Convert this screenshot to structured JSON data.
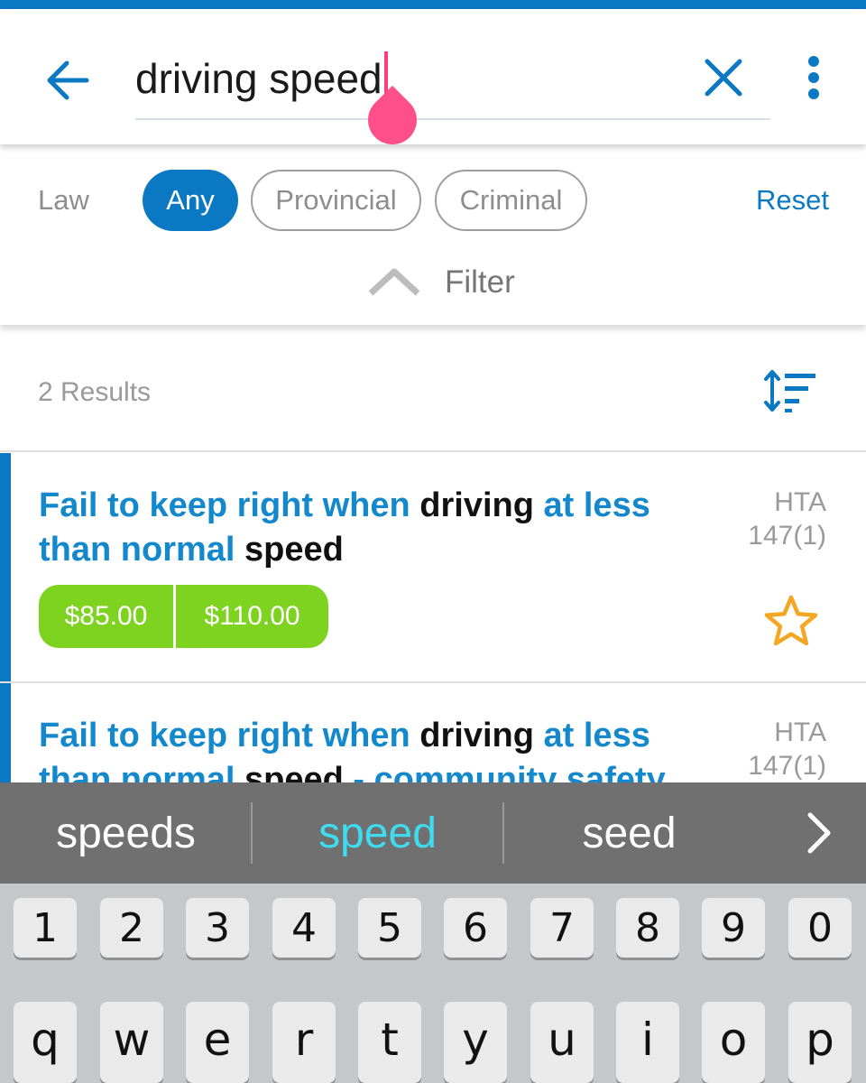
{
  "search": {
    "query": "driving speed"
  },
  "filter": {
    "law_label": "Law",
    "chips": [
      {
        "label": "Any",
        "selected": true
      },
      {
        "label": "Provincial",
        "selected": false
      },
      {
        "label": "Criminal",
        "selected": false
      }
    ],
    "reset_label": "Reset",
    "toggle_label": "Filter"
  },
  "results": {
    "count_label": "2 Results",
    "items": [
      {
        "title_parts": [
          "Fail to keep right when ",
          "driving",
          " at less than normal ",
          "speed"
        ],
        "code_line1": "HTA",
        "code_line2": "147(1)",
        "fines": [
          "$85.00",
          "$110.00"
        ],
        "starred": false
      },
      {
        "title_parts": [
          "Fail to keep right when ",
          "driving",
          " at less than normal ",
          "speed",
          " - community safety"
        ],
        "code_line1": "HTA",
        "code_line2": "147(1)"
      }
    ]
  },
  "suggestions": [
    "speeds",
    "speed",
    "seed"
  ],
  "keyboard": {
    "row1": [
      "1",
      "2",
      "3",
      "4",
      "5",
      "6",
      "7",
      "8",
      "9",
      "0"
    ],
    "row2": [
      "q",
      "w",
      "e",
      "r",
      "t",
      "y",
      "u",
      "i",
      "o",
      "p"
    ]
  },
  "colors": {
    "primary": "#0a78c2",
    "fine_green": "#7ed321",
    "caret_pink": "#ff4f8b",
    "suggest_highlight": "#3ddcf0",
    "star_orange": "#f5a623"
  },
  "icons": [
    "arrow-left-icon",
    "close-icon",
    "more-vert-icon",
    "chevron-up-icon",
    "sort-icon",
    "star-outline-icon",
    "chevron-right-icon"
  ]
}
